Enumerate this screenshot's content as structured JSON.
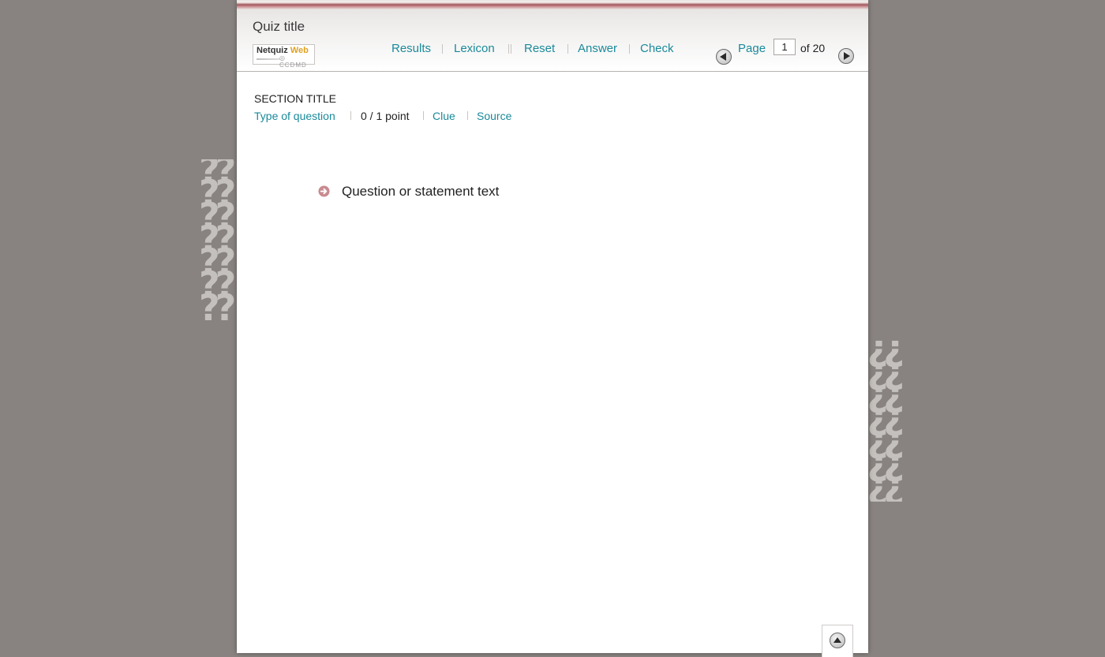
{
  "quiz": {
    "title": "Quiz title"
  },
  "logo": {
    "name": "Netquiz",
    "web": "Web",
    "sub": "CCDMD"
  },
  "toolbar": {
    "results": "Results",
    "lexicon": "Lexicon",
    "reset": "Reset",
    "answer": "Answer",
    "check": "Check"
  },
  "pagination": {
    "label": "Page",
    "current": "1",
    "of_text": "of 20"
  },
  "section": {
    "title": "SECTION TITLE",
    "type_of_question": "Type of question",
    "points": "0 / 1 point",
    "clue": "Clue",
    "source": "Source"
  },
  "question": {
    "text": "Question or statement text"
  },
  "colors": {
    "link": "#1a8a9a",
    "background": "#888380",
    "arrow": "#c98a8f"
  },
  "icons": {
    "prev": "prev-page-icon",
    "next": "next-page-icon",
    "question_bullet": "arrow-right-circle-icon",
    "scroll_top": "scroll-top-icon",
    "decoration": "question-marks-decoration"
  }
}
